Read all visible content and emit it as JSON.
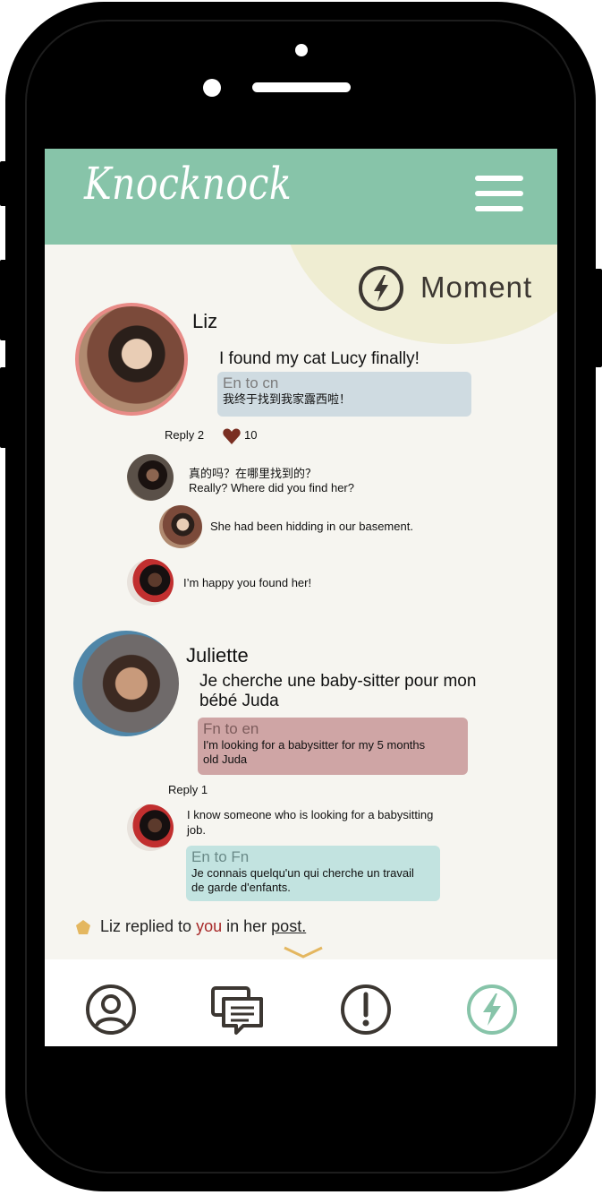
{
  "header": {
    "brand": "Knocknock"
  },
  "moment": {
    "label": "Moment"
  },
  "post1": {
    "author": "Liz",
    "message": "I found my cat Lucy finally!",
    "translation_lang": "En to cn",
    "translation_text": "我终于找到我家露西啦！",
    "reply_count_label": "Reply 2",
    "like_count": "10",
    "replies": [
      {
        "line1": "真的吗？在哪里找到的？",
        "line2": "Really? Where did you find her?"
      },
      {
        "line1": "She had been hidding in our basement."
      },
      {
        "line1": "I’m happy you found her!"
      }
    ]
  },
  "post2": {
    "author": "Juliette",
    "message_line1": "Je cherche une baby-sitter pour mon",
    "message_line2": "bébé Juda",
    "translation_lang": "Fn to en",
    "translation_line1": "I'm looking for a babysitter for my 5 months",
    "translation_line2": "old Juda",
    "reply_count_label": "Reply 1",
    "reply": {
      "line1": "I know someone who is looking for a babysitting",
      "line2": "job.",
      "translation_lang": "En to Fn",
      "translation_line1": "Je connais quelqu'un qui cherche un travail",
      "translation_line2": "de garde d'enfants."
    }
  },
  "notification": {
    "prefix": "Liz replied to",
    "you": "you",
    "middle": "in her",
    "link": "post."
  },
  "nav": {
    "items": [
      "profile-icon",
      "chat-icon",
      "alert-icon",
      "moment-icon"
    ],
    "active_color": "#87c4a9"
  },
  "colors": {
    "header": "#87c4a9",
    "moment_bg": "#efedd2",
    "accent_red": "#a82a2a",
    "liz_ring": "#e88b87"
  }
}
